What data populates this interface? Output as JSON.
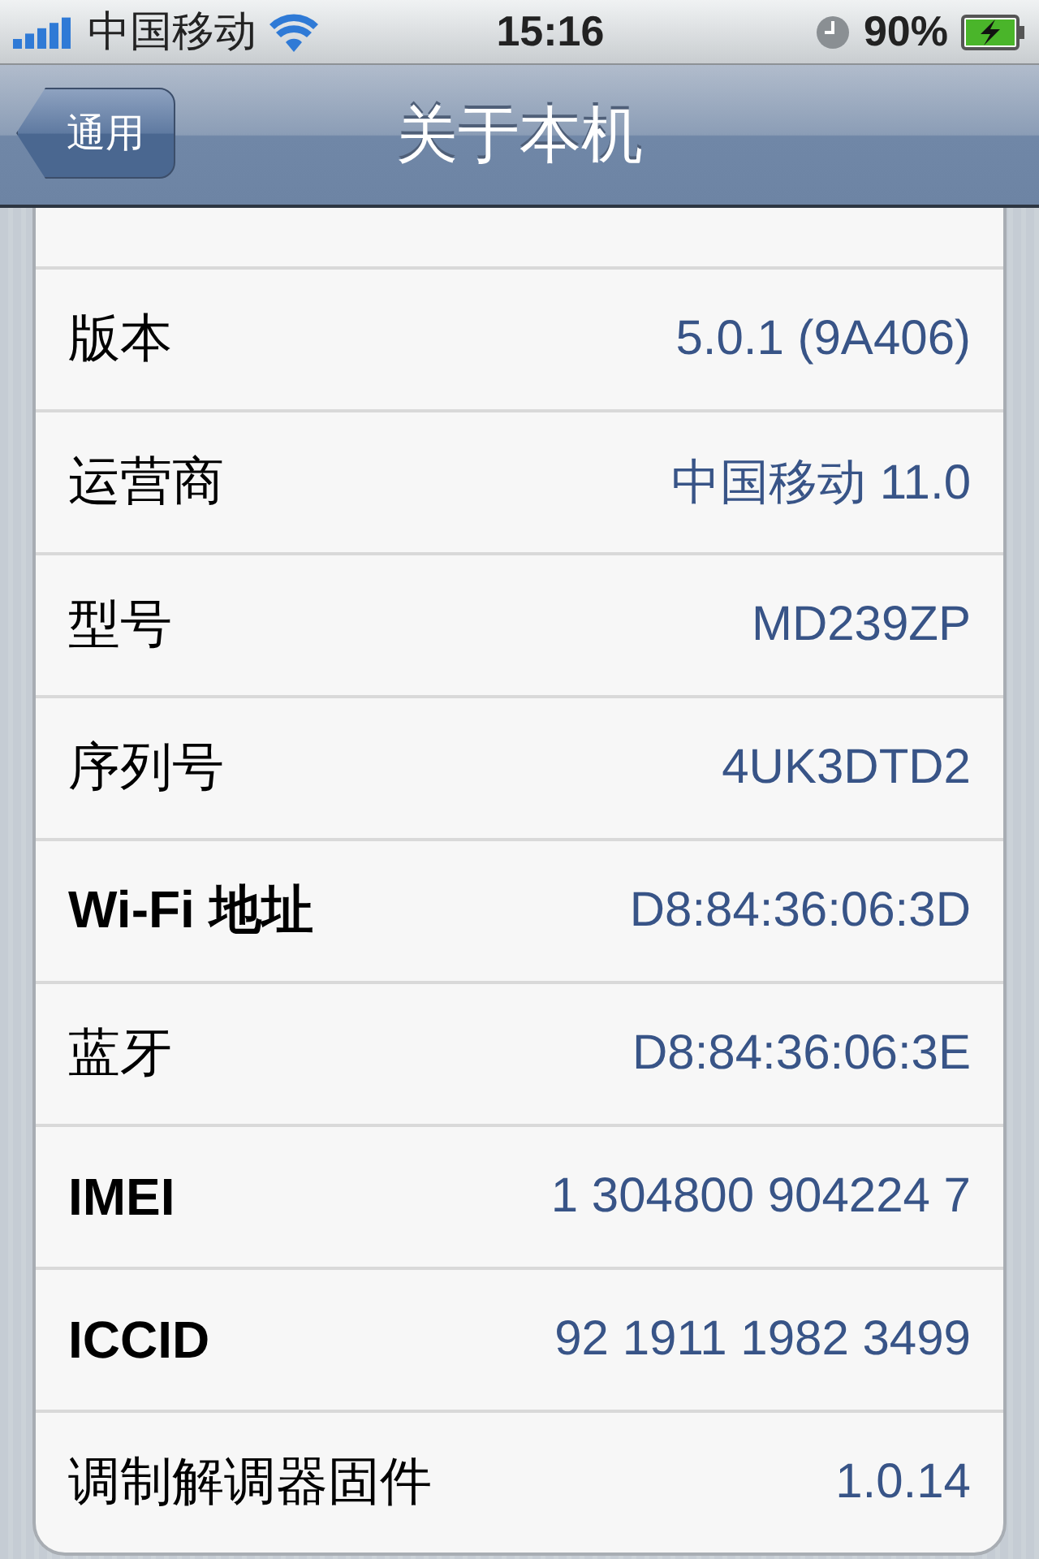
{
  "status_bar": {
    "carrier": "中国移动",
    "time": "15:16",
    "battery": "90%"
  },
  "nav_bar": {
    "back": "通用",
    "title": "关于本机"
  },
  "rows": [
    {
      "kind": "cjk",
      "label": "版本",
      "value": "5.0.1 (9A406)"
    },
    {
      "kind": "cjk",
      "label": "运营商",
      "value": "中国移动 11.0"
    },
    {
      "kind": "cjk",
      "label": "型号",
      "value": "MD239ZP"
    },
    {
      "kind": "cjk",
      "label": "序列号",
      "value": "4UK3DTD2"
    },
    {
      "kind": "latin",
      "label": "Wi-Fi 地址",
      "value": "D8:84:36:06:3D"
    },
    {
      "kind": "cjk",
      "label": "蓝牙",
      "value": "D8:84:36:06:3E"
    },
    {
      "kind": "latin",
      "label": "IMEI",
      "value": "1 304800 904224 7"
    },
    {
      "kind": "latin",
      "label": "ICCID",
      "value": "92 1911 1982 3499"
    },
    {
      "kind": "cjk",
      "label": "调制解调器固件",
      "value": "1.0.14"
    }
  ]
}
